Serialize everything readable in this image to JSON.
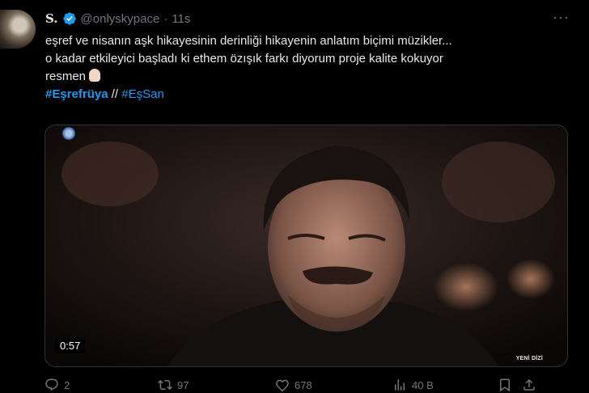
{
  "tweet": {
    "display_name": "S.",
    "handle": "@onlyskypace",
    "separator": "·",
    "time": "11s",
    "more_label": "···",
    "text_line1": "eşref ve nisanın aşk hikayesinin derinliği hikayenin anlatım biçimi müzikler...",
    "text_line2": "o kadar etkileyici başladı ki ethem özışık farkı diyorum proje kalite kokuyor",
    "text_line3": "resmen",
    "hashtag1": "#Eşrefrüya",
    "hashtag_separator": "//",
    "hashtag2": "#EşSan"
  },
  "media": {
    "duration": "0:57",
    "watermark": "YENİ DİZİ"
  },
  "actions": {
    "reply_count": "2",
    "retweet_count": "97",
    "like_count": "678",
    "views_count": "40 B"
  },
  "colors": {
    "background": "#000000",
    "text": "#e7e9ea",
    "muted": "#71767b",
    "accent": "#1d9bf0"
  },
  "icons": [
    "verified-badge-icon",
    "more-icon",
    "reply-icon",
    "retweet-icon",
    "like-icon",
    "views-icon",
    "bookmark-icon",
    "share-icon",
    "hand-emoji-icon"
  ]
}
